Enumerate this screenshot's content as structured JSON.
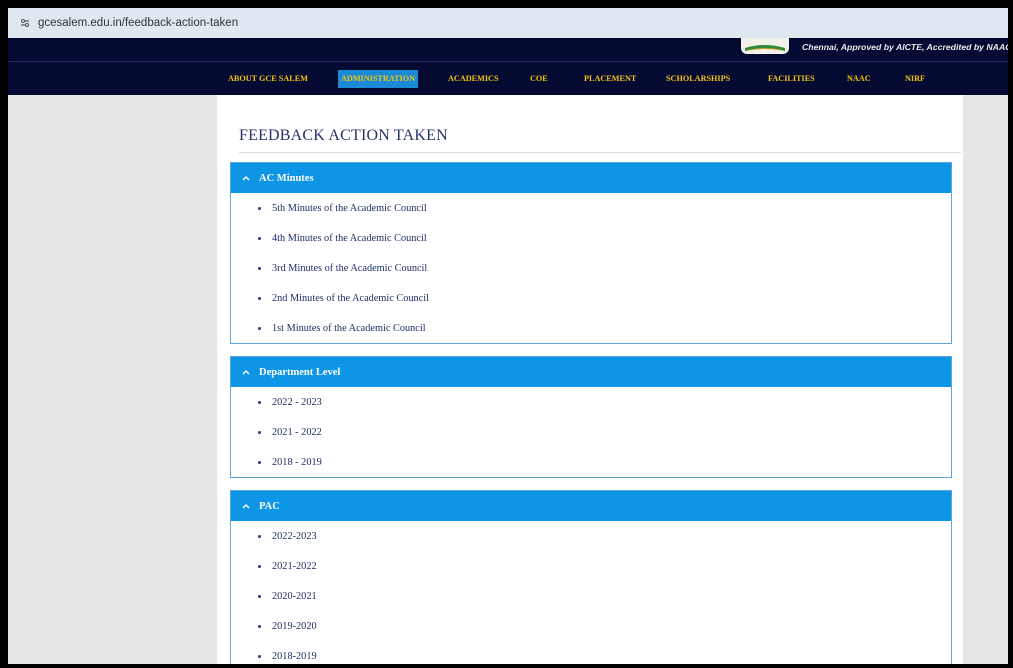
{
  "browser": {
    "url": "gcesalem.edu.in/feedback-action-taken",
    "site_icon": "site-settings-icon"
  },
  "header": {
    "tagline": "Chennai, Approved by AICTE, Accredited by NAAC."
  },
  "nav": {
    "items": [
      {
        "label": "ABOUT GCE SALEM"
      },
      {
        "label": "ADMINISTRATION"
      },
      {
        "label": "ACADEMICS"
      },
      {
        "label": "COE"
      },
      {
        "label": "PLACEMENT"
      },
      {
        "label": "SCHOLARSHIPS"
      },
      {
        "label": "FACILITIES"
      },
      {
        "label": "NAAC"
      },
      {
        "label": "NIRF"
      }
    ],
    "active": "ADMINISTRATION"
  },
  "page": {
    "title": "FEEDBACK ACTION TAKEN"
  },
  "sections": [
    {
      "title": "AC Minutes",
      "items": [
        "5th Minutes of the Academic Council",
        "4th Minutes of the Academic Council",
        "3rd Minutes of the Academic Council",
        "2nd Minutes of the Academic Council",
        "1st Minutes of the Academic Council"
      ]
    },
    {
      "title": "Department Level",
      "items": [
        "2022 - 2023",
        "2021 - 2022",
        "2018 - 2019"
      ]
    },
    {
      "title": "PAC",
      "items": [
        "2022-2023",
        "2021-2022",
        "2020-2021",
        "2019-2020",
        "2018-2019"
      ]
    }
  ],
  "colors": {
    "nav_bg": "#050a33",
    "nav_text": "#f2c40f",
    "nav_active_bg": "#1a8ad6",
    "panel_header": "#0d95e6",
    "panel_border": "#5aa7df",
    "title_text": "#25336a"
  }
}
